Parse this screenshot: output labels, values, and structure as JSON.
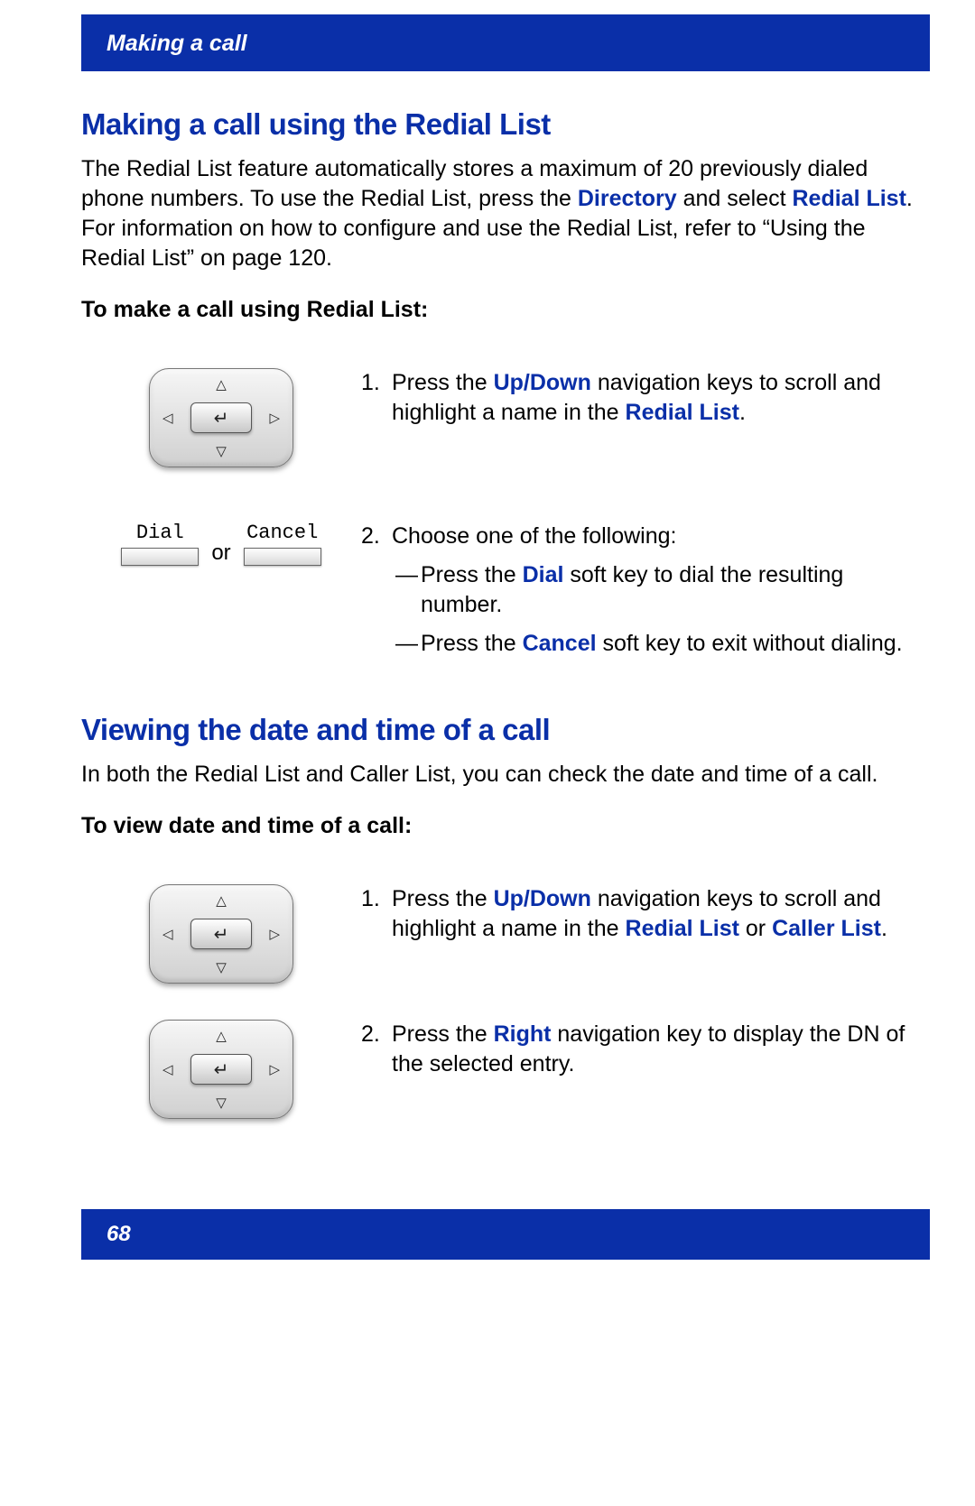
{
  "header": {
    "title": "Making a call"
  },
  "section1": {
    "title": "Making a call using the Redial List",
    "intro_pre": "The Redial List feature automatically stores a maximum of 20 previously dialed phone numbers. To use the Redial List, press the ",
    "intro_link1": "Directory",
    "intro_mid1": " and select ",
    "intro_link2": "Redial List",
    "intro_post": ". For information on how to configure and use the Redial List, refer to “Using the Redial List” on page 120.",
    "subhead": "To make a call using Redial List:",
    "step1": {
      "num": "1.",
      "pre": "Press the ",
      "link1": "Up/Down",
      "mid": " navigation keys to scroll and highlight a name in the ",
      "link2": "Redial List",
      "post": "."
    },
    "step2": {
      "num": "2.",
      "lead": "Choose one of the following:",
      "bullet1_pre": "Press the ",
      "bullet1_link": "Dial",
      "bullet1_post": " soft key to dial the resulting number.",
      "bullet2_pre": "Press the ",
      "bullet2_link": "Cancel",
      "bullet2_post": " soft key to exit without dialing."
    },
    "softkeys": {
      "dial": "Dial",
      "cancel": "Cancel",
      "or": "or"
    }
  },
  "section2": {
    "title": "Viewing the date and time of a call",
    "intro": "In both the Redial List and Caller List, you can check the date and time of a call.",
    "subhead": "To view date and time of a call:",
    "step1": {
      "num": "1.",
      "pre": "Press the ",
      "link1": "Up/Down",
      "mid": " navigation keys to scroll and highlight a name in the ",
      "link2": "Redial List",
      "or": " or ",
      "link3": "Caller List",
      "post": "."
    },
    "step2": {
      "num": "2.",
      "pre": "Press the ",
      "link1": "Right",
      "post": " navigation key to display the DN of the selected entry."
    }
  },
  "footer": {
    "page": "68"
  }
}
